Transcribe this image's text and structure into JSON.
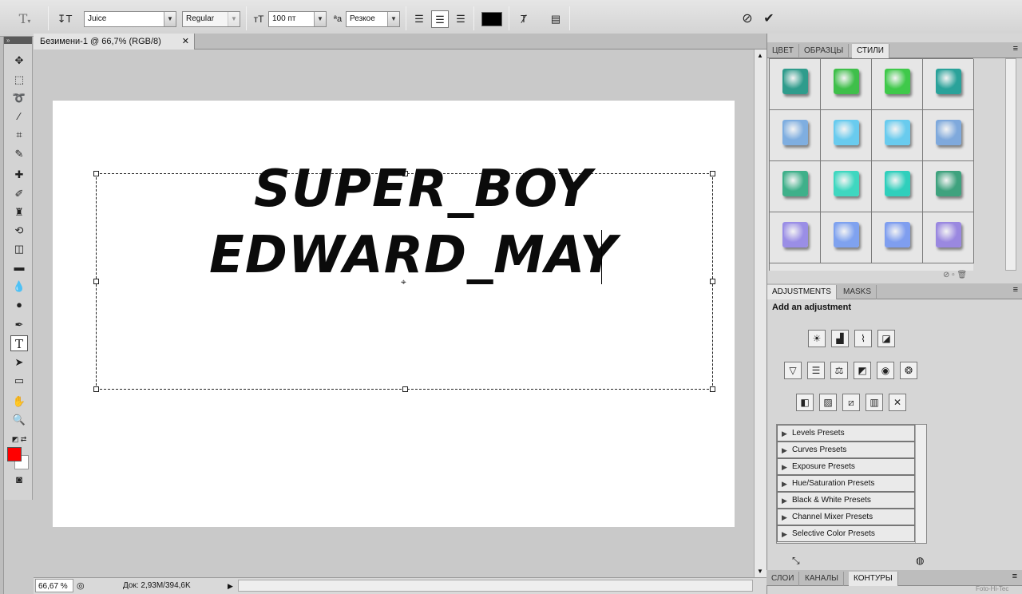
{
  "options_bar": {
    "font_family": "Juice",
    "font_style": "Regular",
    "font_size": "100 пт",
    "antialias": "Резкое",
    "text_color": "#000000"
  },
  "document": {
    "tab_title": "Безимени-1 @ 66,7% (RGB/8)",
    "close_glyph": "✕",
    "line1": "SUPER_BOY",
    "line2": "EDWARD_MAY"
  },
  "status": {
    "zoom": "66,67 %",
    "doc_info": "Док: 2,93M/394,6K"
  },
  "styles_panel": {
    "tabs": [
      "ЦВЕТ",
      "ОБРАЗЦЫ",
      "СТИЛИ"
    ],
    "active_tab": "СТИЛИ",
    "swatch_colors": [
      [
        "#2f9c8c",
        "#3fbf4a",
        "#3fc94a",
        "#2aa29a"
      ],
      [
        "#7faee0",
        "#69cbee",
        "#69cbee",
        "#7fa9dc"
      ],
      [
        "#3fb08a",
        "#3fd7c0",
        "#2fcfbc",
        "#3fa27e"
      ],
      [
        "#9a8ee6",
        "#7fa2ef",
        "#7f9eef",
        "#9a88e0"
      ]
    ]
  },
  "adjustments_panel": {
    "tabs": [
      "ADJUSTMENTS",
      "MASKS"
    ],
    "active_tab": "ADJUSTMENTS",
    "heading": "Add an adjustment",
    "presets": [
      "Levels Presets",
      "Curves Presets",
      "Exposure Presets",
      "Hue/Saturation Presets",
      "Black & White Presets",
      "Channel Mixer Presets",
      "Selective Color Presets"
    ]
  },
  "layers_panel": {
    "tabs": [
      "СЛОИ",
      "КАНАЛЫ",
      "КОНТУРЫ"
    ],
    "active_tab": "КОНТУРЫ"
  },
  "colors": {
    "foreground": "#ff0000",
    "background": "#ffffff"
  },
  "watermark": "Foto-Hi-Tec"
}
